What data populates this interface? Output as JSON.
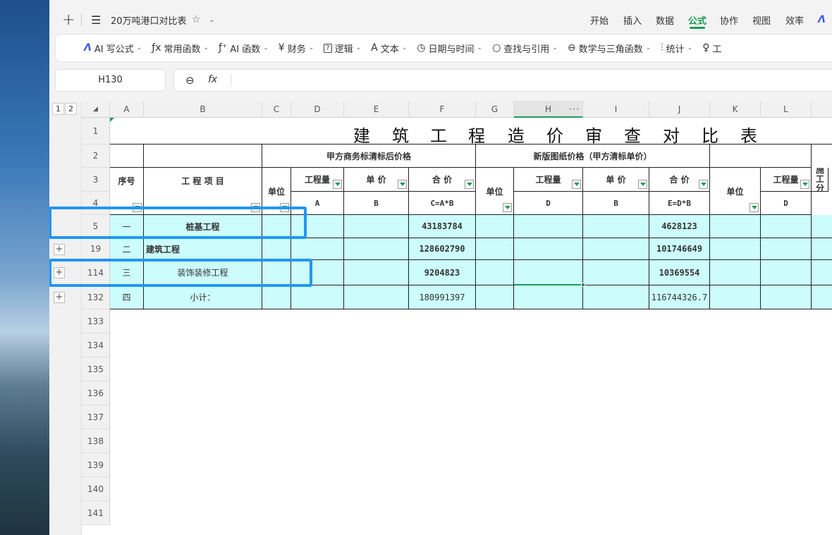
{
  "window": {
    "doc_title": "20万吨港口对比表",
    "tabs": [
      "开始",
      "插入",
      "数据",
      "公式",
      "协作",
      "视图",
      "效率"
    ],
    "active_tab": "公式"
  },
  "ribbon": [
    {
      "icon": "ai-logo-icon",
      "label": "AI 写公式"
    },
    {
      "icon": "function-icon",
      "label": "常用函数"
    },
    {
      "icon": "ai-function-icon",
      "label": "AI 函数"
    },
    {
      "icon": "yen-icon",
      "label": "财务"
    },
    {
      "icon": "logic-icon",
      "label": "逻辑"
    },
    {
      "icon": "text-icon",
      "label": "文本"
    },
    {
      "icon": "clock-icon",
      "label": "日期与时间"
    },
    {
      "icon": "search-icon",
      "label": "查找与引用"
    },
    {
      "icon": "math-icon",
      "label": "数学与三角函数"
    },
    {
      "icon": "stats-icon",
      "label": "统计"
    },
    {
      "icon": "tool-icon",
      "label": "工"
    }
  ],
  "formula_bar": {
    "name_box": "H130",
    "fx": "fx"
  },
  "outline_levels": [
    "1",
    "2"
  ],
  "columns": [
    "A",
    "B",
    "C",
    "D",
    "E",
    "F",
    "G",
    "H",
    "I",
    "J",
    "K",
    "L"
  ],
  "row_numbers": [
    "1",
    "2",
    "3",
    "4",
    "5",
    "19",
    "114",
    "132",
    "133",
    "134",
    "135",
    "136",
    "137",
    "138",
    "139",
    "140",
    "141"
  ],
  "title": {
    "chars": [
      "建",
      "筑",
      "工",
      "程",
      "造",
      "价",
      "审",
      "查",
      "对",
      "比",
      "表"
    ]
  },
  "header": {
    "group1": "甲方商务标清标后价格",
    "group2": "新版图纸价格（甲方清标单价）",
    "seq": "序号",
    "project": "工 程 项 目",
    "unit": "单位",
    "qty": "工程量",
    "price": "单 价",
    "total": "合 价",
    "unit_g": "单位",
    "unit_k": "单位",
    "qty_l": "工程量",
    "m_cut": "施工分",
    "sub_d": "A",
    "sub_e": "B",
    "sub_f": "C=A*B",
    "sub_h": "D",
    "sub_i": "B",
    "sub_j": "E=D*B",
    "sub_l": "D"
  },
  "rows": [
    {
      "seq": "一",
      "name": "桩基工程",
      "f": "43183784",
      "j": "4628123"
    },
    {
      "seq": "二",
      "name": "建筑工程",
      "f": "128602790",
      "j": "101746649"
    },
    {
      "seq": "三",
      "name": "装饰装修工程",
      "f": "9204823",
      "j": "10369554"
    },
    {
      "seq": "四",
      "name": "小计：",
      "f": "180991397",
      "j": "116744326.7"
    }
  ],
  "colors": {
    "highlight": "#2196f3",
    "row_fill": "#ccfcfc",
    "accent": "#1e9b57"
  }
}
